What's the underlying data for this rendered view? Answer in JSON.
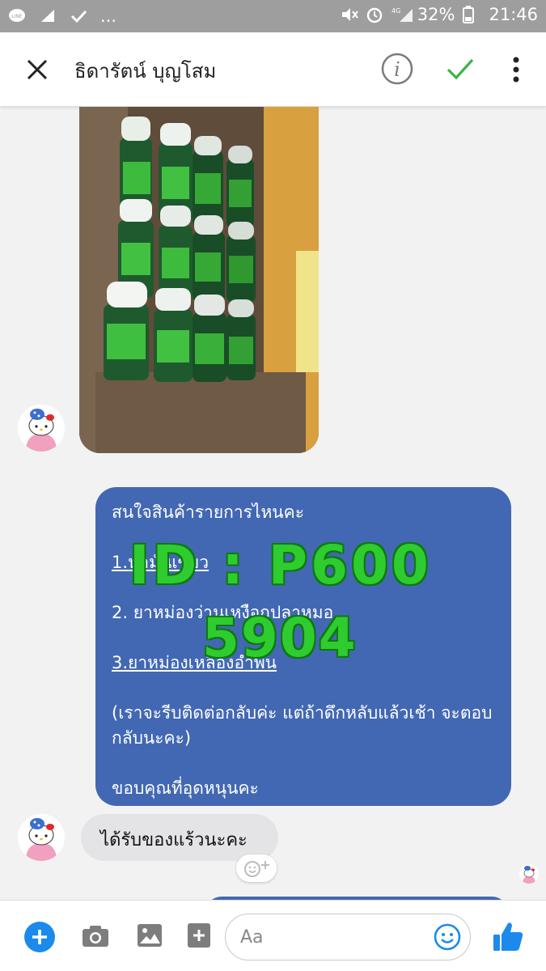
{
  "status_bar": {
    "battery": "32%",
    "time": "21:46",
    "network": "4G"
  },
  "header": {
    "contact_name": "ธิดารัตน์ บุญโสม"
  },
  "messages": {
    "menu_lines": [
      "สนใจสินค้ารายการไหนคะ",
      "1.น้ำมันเขียว",
      "2. ยาหม่องว่านเหงือกปลาหมอ",
      "3.ยาหม่องเหลืองอำพัน",
      "(เราจะรีบติดต่อกลับค่ะ  แต่ถ้าดึกหลับแล้วเช้า จะตอบกลับนะคะ)",
      "ขอบคุณที่อุดหนุนคะ"
    ],
    "reply": "ได้รับของแร้วนะคะ"
  },
  "watermark": {
    "line1": "ID : P600",
    "line2": "5904"
  },
  "composer": {
    "placeholder": "Aa"
  },
  "colors": {
    "brand_blue": "#4268b3",
    "messenger_blue": "#1c8aed",
    "check_green": "#3ab54a"
  }
}
